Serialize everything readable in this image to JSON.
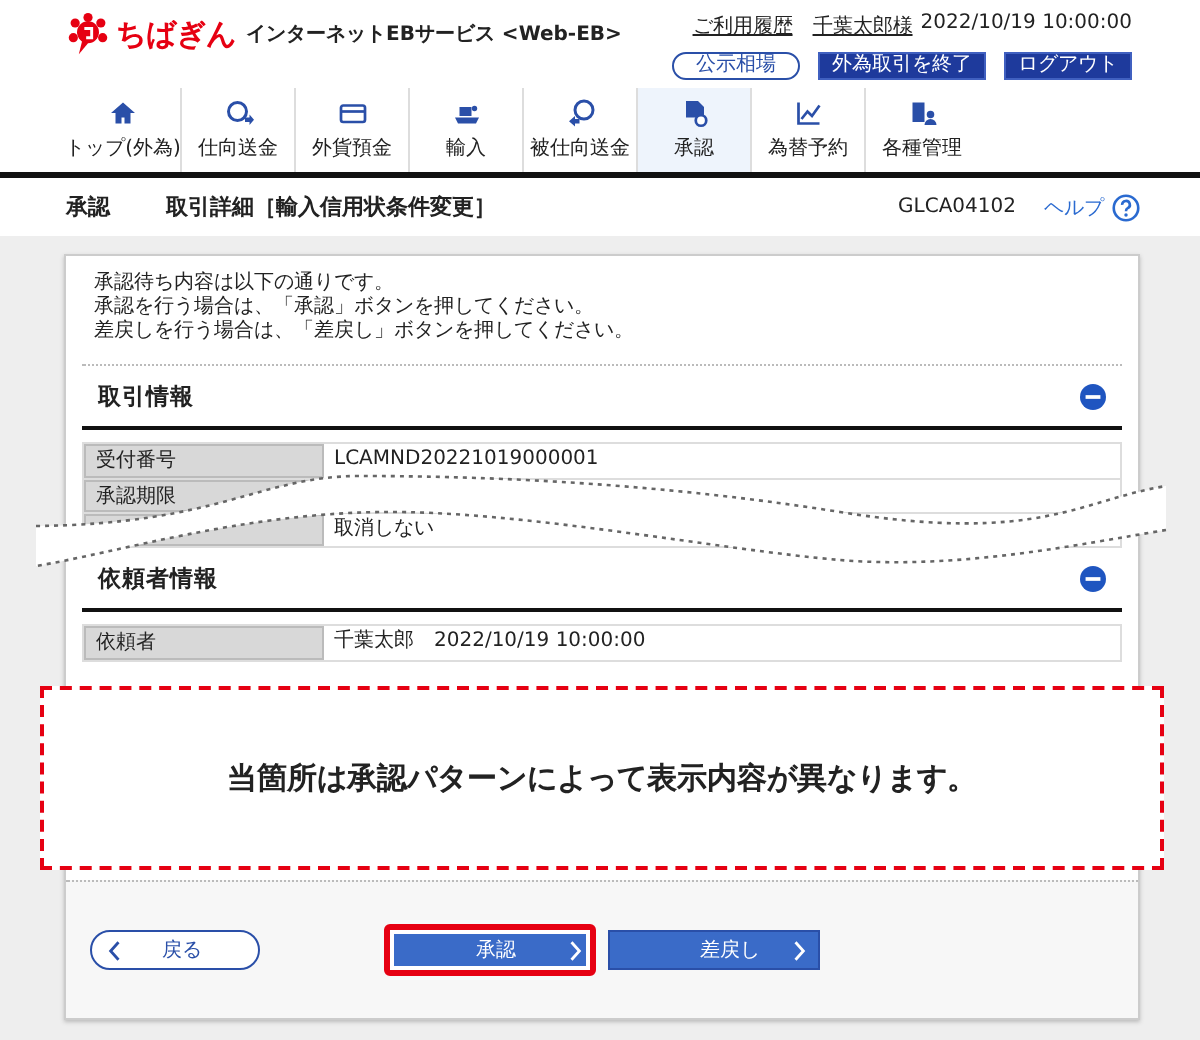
{
  "header": {
    "logo_text": "ちばぎん",
    "service_name": "インターネットEBサービス <Web-EB>",
    "links": [
      "ご利用履歴",
      "千葉太郎様"
    ],
    "datetime": "2022/10/19 10:00:00",
    "buttons": [
      {
        "label": "公示相場",
        "kind": "outline"
      },
      {
        "label": "外為取引を終了",
        "kind": "solid"
      },
      {
        "label": "ログアウト",
        "kind": "solid"
      }
    ]
  },
  "nav": [
    {
      "label": "トップ(外為)",
      "selected": false
    },
    {
      "label": "仕向送金",
      "selected": false
    },
    {
      "label": "外貨預金",
      "selected": false
    },
    {
      "label": "輸入",
      "selected": false
    },
    {
      "label": "被仕向送金",
      "selected": false
    },
    {
      "label": "承認",
      "selected": true
    },
    {
      "label": "為替予約",
      "selected": false
    },
    {
      "label": "各種管理",
      "selected": false
    }
  ],
  "page": {
    "section": "承認",
    "title": "取引詳細［輸入信用状条件変更］",
    "screen_id": "GLCA04102",
    "help": "ヘルプ"
  },
  "message": [
    "承認待ち内容は以下の通りです。",
    "承認を行う場合は、「承認」ボタンを押してください。",
    "差戻しを行う場合は、「差戻し」ボタンを押してください。"
  ],
  "sections": [
    {
      "title": "取引情報",
      "expanded": true,
      "rows": [
        {
          "label": "受付番号",
          "value": "LCAMND20221019000001"
        },
        {
          "label": "承認期限"
        },
        {
          "value": "取消しない"
        }
      ]
    },
    {
      "title": "依頼者情報",
      "expanded": true,
      "rows": [
        {
          "label": "依頼者",
          "value": "千葉太郎　2022/10/19 10:00:00"
        }
      ]
    }
  ],
  "annotation": {
    "text": "当箇所は承認パターンによって表示内容が異なります。"
  },
  "buttons": [
    {
      "label": "戻る",
      "kind": "back",
      "highlighted": false
    },
    {
      "label": "承認",
      "kind": "primary",
      "highlighted": true
    },
    {
      "label": "差戻し",
      "kind": "primary",
      "highlighted": false
    }
  ]
}
